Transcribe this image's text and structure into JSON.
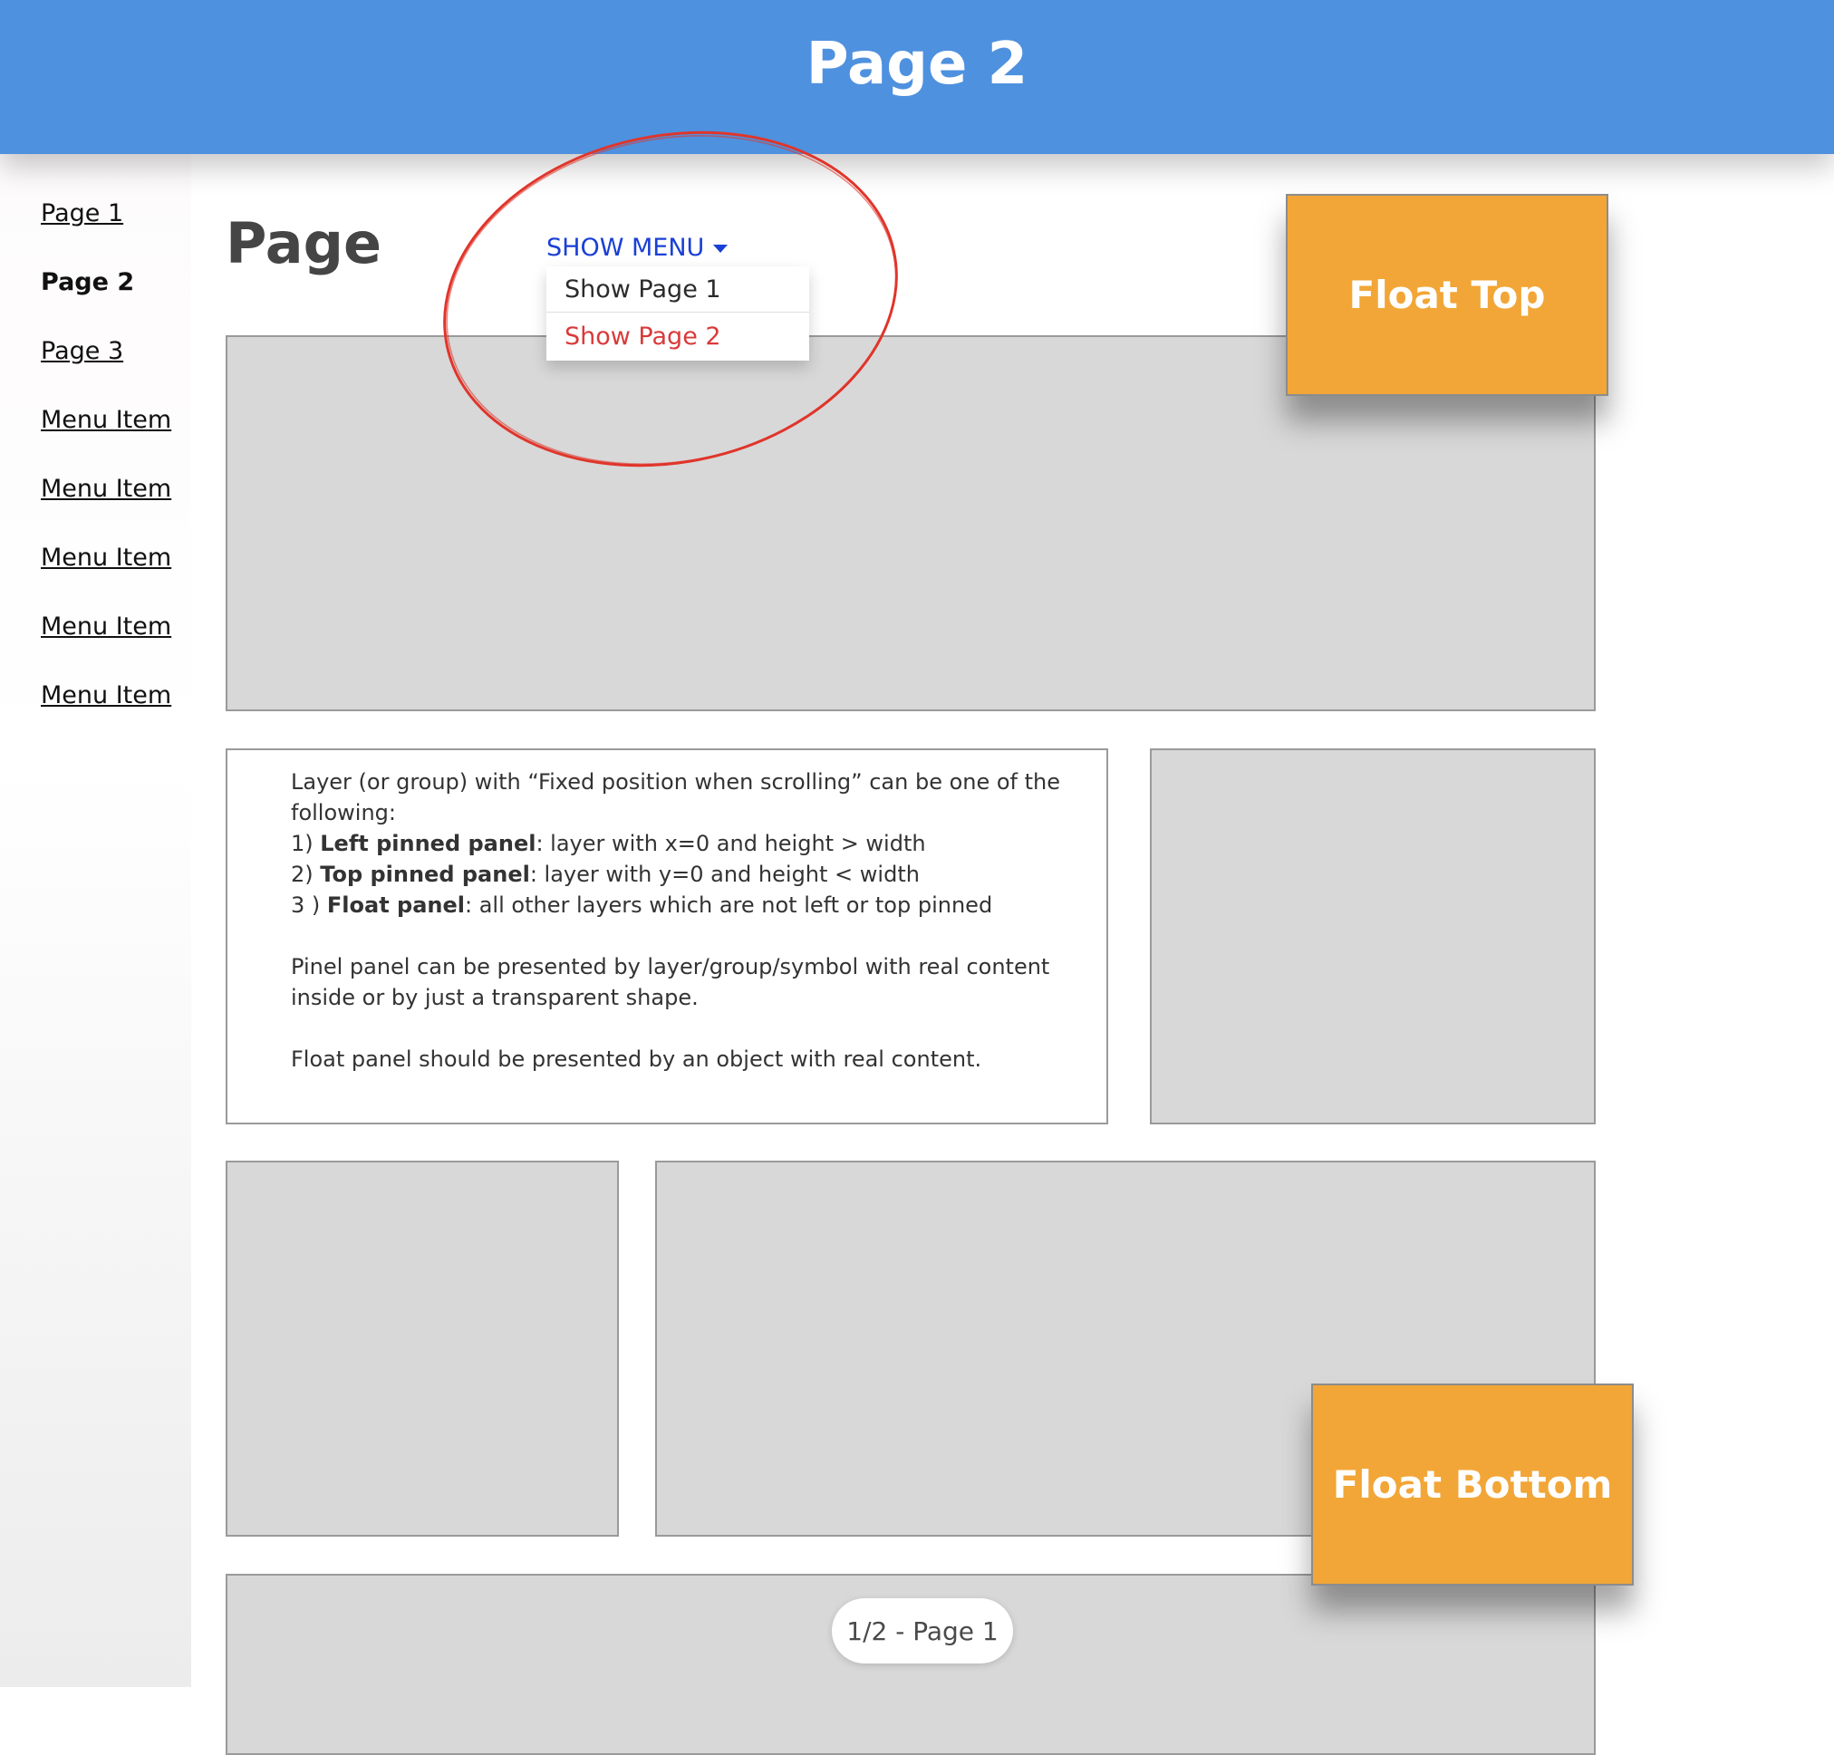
{
  "header": {
    "title": "Page 2"
  },
  "sidebar": {
    "items": [
      {
        "label": "Page 1"
      },
      {
        "label": "Page 2"
      },
      {
        "label": "Page 3"
      },
      {
        "label": "Menu Item"
      },
      {
        "label": "Menu Item"
      },
      {
        "label": "Menu Item"
      },
      {
        "label": "Menu Item"
      },
      {
        "label": "Menu Item"
      }
    ],
    "active_label": "Page 2"
  },
  "main": {
    "heading": "Page",
    "show_menu": {
      "label": "SHOW MENU",
      "options": [
        "Show Page 1",
        "Show Page 2"
      ],
      "selected": "Show Page 2"
    },
    "text_panel": {
      "line1": "Layer (or group) with “Fixed position when scrolling” can be one of the following:",
      "item1_prefix": "1)  ",
      "item1_bold": "Left pinned panel",
      "item1_rest": ": layer with x=0 and height > width",
      "item2_prefix": "2)  ",
      "item2_bold": "Top pinned panel",
      "item2_rest": ": layer with y=0 and height < width",
      "item3_prefix": "3 ) ",
      "item3_bold": "Float panel",
      "item3_rest": ":  all other layers which are not left or top pinned",
      "para2": "Pinel panel can be presented by  layer/group/symbol with real content inside or by just a transparent shape.",
      "para3": "Float panel should be presented by an object with real content."
    }
  },
  "float_top": {
    "label": "Float Top"
  },
  "float_bottom": {
    "label": "Float Bottom"
  },
  "page_indicator": {
    "label": "1/2 - Page 1"
  },
  "colors": {
    "header": "#4e91df",
    "float": "#f2a637",
    "link": "#1a3fd6",
    "selected_option": "#d93a3a",
    "annotation": "#e0352b"
  }
}
